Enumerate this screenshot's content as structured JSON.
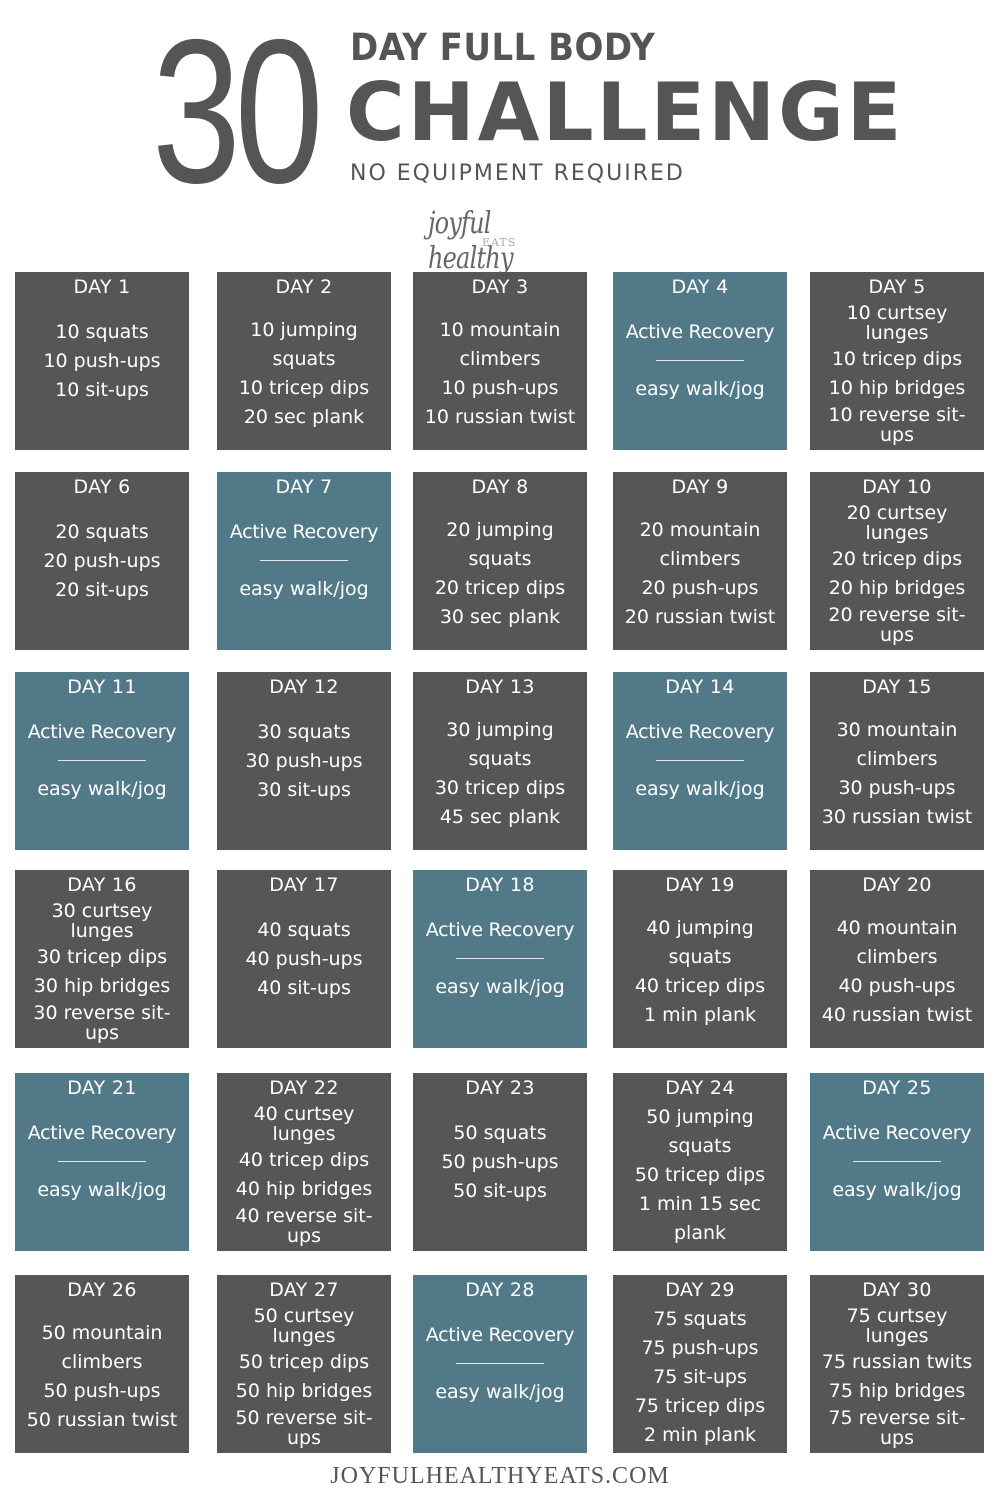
{
  "header": {
    "big_number": "30",
    "line1": "DAY FULL BODY",
    "line2": "CHALLENGE",
    "line3": "NO EQUIPMENT REQUIRED"
  },
  "logo": {
    "script": "joyful healthy",
    "sub": "EATS"
  },
  "colors": {
    "workout_tile": "#565656",
    "recovery_tile": "#527987",
    "text_dark": "#555555"
  },
  "days": [
    {
      "label": "DAY 1",
      "type": "workout",
      "lines": [
        "10 squats",
        "10 push-ups",
        "10 sit-ups"
      ]
    },
    {
      "label": "DAY 2",
      "type": "workout",
      "lines": [
        "10 jumping squats",
        "10 tricep dips",
        "20 sec plank"
      ]
    },
    {
      "label": "DAY 3",
      "type": "workout",
      "lines": [
        "10 mountain climbers",
        "10 push-ups",
        "10 russian twist"
      ]
    },
    {
      "label": "DAY 4",
      "type": "recovery",
      "title": "Active Recovery",
      "detail": "easy walk/jog"
    },
    {
      "label": "DAY 5",
      "type": "workout",
      "lines": [
        "10 curtsey lunges",
        "10 tricep dips",
        "10 hip bridges",
        "10 reverse sit-ups"
      ]
    },
    {
      "label": "DAY 6",
      "type": "workout",
      "lines": [
        "20 squats",
        "20 push-ups",
        "20 sit-ups"
      ]
    },
    {
      "label": "DAY 7",
      "type": "recovery",
      "title": "Active Recovery",
      "detail": "easy walk/jog"
    },
    {
      "label": "DAY 8",
      "type": "workout",
      "lines": [
        "20 jumping squats",
        "20 tricep dips",
        "30 sec plank"
      ]
    },
    {
      "label": "DAY 9",
      "type": "workout",
      "lines": [
        "20 mountain climbers",
        "20 push-ups",
        "20 russian twist"
      ]
    },
    {
      "label": "DAY 10",
      "type": "workout",
      "lines": [
        "20 curtsey lunges",
        "20 tricep dips",
        "20 hip bridges",
        "20 reverse sit-ups"
      ]
    },
    {
      "label": "DAY 11",
      "type": "recovery",
      "title": "Active Recovery",
      "detail": "easy walk/jog"
    },
    {
      "label": "DAY 12",
      "type": "workout",
      "lines": [
        "30 squats",
        "30 push-ups",
        "30 sit-ups"
      ]
    },
    {
      "label": "DAY 13",
      "type": "workout",
      "lines": [
        "30 jumping squats",
        "30 tricep dips",
        "45 sec plank"
      ]
    },
    {
      "label": "DAY 14",
      "type": "recovery",
      "title": "Active Recovery",
      "detail": "easy walk/jog"
    },
    {
      "label": "DAY 15",
      "type": "workout",
      "lines": [
        "30 mountain climbers",
        "30 push-ups",
        "30 russian twist"
      ]
    },
    {
      "label": "DAY 16",
      "type": "workout",
      "lines": [
        "30 curtsey lunges",
        "30 tricep dips",
        "30 hip bridges",
        "30 reverse sit-ups"
      ]
    },
    {
      "label": "DAY 17",
      "type": "workout",
      "lines": [
        "40 squats",
        "40 push-ups",
        "40 sit-ups"
      ]
    },
    {
      "label": "DAY 18",
      "type": "recovery",
      "title": "Active Recovery",
      "detail": "easy walk/jog"
    },
    {
      "label": "DAY 19",
      "type": "workout",
      "lines": [
        "40 jumping squats",
        "40 tricep dips",
        "1 min plank"
      ]
    },
    {
      "label": "DAY 20",
      "type": "workout",
      "lines": [
        "40 mountain climbers",
        "40 push-ups",
        "40 russian twist"
      ]
    },
    {
      "label": "DAY 21",
      "type": "recovery",
      "title": "Active Recovery",
      "detail": "easy walk/jog"
    },
    {
      "label": "DAY 22",
      "type": "workout",
      "lines": [
        "40 curtsey lunges",
        "40 tricep dips",
        "40 hip bridges",
        "40 reverse sit-ups"
      ]
    },
    {
      "label": "DAY 23",
      "type": "workout",
      "lines": [
        "50 squats",
        "50 push-ups",
        "50 sit-ups"
      ]
    },
    {
      "label": "DAY 24",
      "type": "workout",
      "lines": [
        "50 jumping squats",
        "50 tricep dips",
        "1 min 15 sec plank"
      ]
    },
    {
      "label": "DAY 25",
      "type": "recovery",
      "title": "Active Recovery",
      "detail": "easy walk/jog"
    },
    {
      "label": "DAY 26",
      "type": "workout",
      "lines": [
        "50 mountain climbers",
        "50 push-ups",
        "50 russian twist"
      ]
    },
    {
      "label": "DAY 27",
      "type": "workout",
      "lines": [
        "50 curtsey lunges",
        "50 tricep dips",
        "50 hip bridges",
        "50 reverse sit-ups"
      ]
    },
    {
      "label": "DAY 28",
      "type": "recovery",
      "title": "Active Recovery",
      "detail": "easy walk/jog"
    },
    {
      "label": "DAY 29",
      "type": "workout",
      "lines": [
        "75 squats",
        "75 push-ups",
        "75 sit-ups",
        "75 tricep dips",
        "2 min plank"
      ]
    },
    {
      "label": "DAY 30",
      "type": "workout",
      "lines": [
        "75 curtsey lunges",
        "75 russian twits",
        "75 hip bridges",
        "75 reverse sit-ups"
      ]
    }
  ],
  "footer": "JOYFULHEALTHYEATS.COM"
}
